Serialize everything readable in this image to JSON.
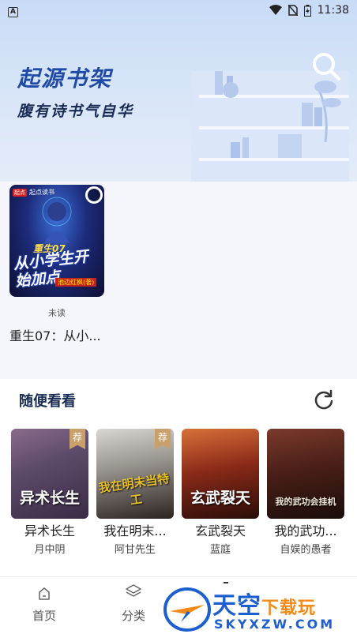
{
  "status_bar": {
    "notification_icon": "A",
    "time": "11:38"
  },
  "header": {
    "title": "起源书架",
    "slogan": "腹有诗书气自华",
    "search_icon": "search-icon"
  },
  "shelf": {
    "books": [
      {
        "cover_publisher": "起点读书",
        "cover_sub_title": "重生07",
        "cover_main_title": "从小学生开始加点",
        "cover_author": "池边红枫(著)",
        "status": "未读",
        "name": "重生07：从小..."
      }
    ]
  },
  "random": {
    "title": "随便看看",
    "refresh_icon": "refresh-icon",
    "items": [
      {
        "cover_title": "异术长生",
        "badge": "荐",
        "name": "异术长生",
        "author": "月中阴",
        "colors": [
          "#8a6b8c",
          "#3b2b45"
        ]
      },
      {
        "cover_title": "我在明末当特工",
        "badge": "荐",
        "name": "我在明末...",
        "author": "阿甘先生",
        "colors": [
          "#c9c7c2",
          "#2b2320"
        ]
      },
      {
        "cover_title": "玄武裂天",
        "badge": "",
        "name": "玄武裂天",
        "author": "蓝庭",
        "colors": [
          "#b84a2a",
          "#2a0d08"
        ]
      },
      {
        "cover_title": "我的武功会挂机",
        "badge": "",
        "name": "我的武功...",
        "author": "自娱的愚者",
        "colors": [
          "#5a2a22",
          "#1a0d0a"
        ]
      }
    ]
  },
  "bottom_nav": {
    "items": [
      {
        "label": "首页",
        "icon": "home-icon"
      },
      {
        "label": "分类",
        "icon": "layers-icon"
      }
    ]
  },
  "watermark": {
    "line1_blue": "天空",
    "line1_orange": "下载玩",
    "line2": "SKYXZW.COM"
  }
}
